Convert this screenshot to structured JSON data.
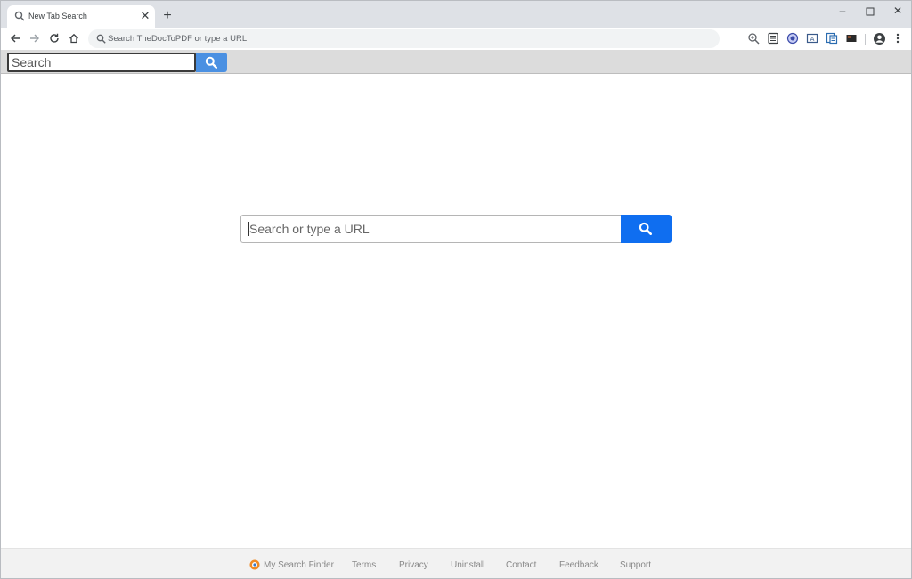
{
  "browser": {
    "tab": {
      "title": "New Tab Search",
      "favicon": "search-icon",
      "close_glyph": "✕"
    },
    "new_tab_glyph": "+",
    "window_controls": {
      "minimize": "–",
      "maximize": "☐",
      "close": "✕"
    },
    "omnibox": {
      "text": "Search TheDocToPDF or type a URL"
    },
    "extensions": [
      "zoom-icon",
      "note-icon",
      "record-icon",
      "translate-icon",
      "docs-icon",
      "media-icon"
    ]
  },
  "extension_bar": {
    "search_placeholder": "Search"
  },
  "main": {
    "search_placeholder": "Search or type a URL"
  },
  "footer": {
    "brand": "My Search Finder",
    "links": [
      "Terms",
      "Privacy",
      "Uninstall",
      "Contact",
      "Feedback",
      "Support"
    ]
  },
  "colors": {
    "tabstrip": "#dee1e6",
    "extbar": "#dcdcdc",
    "extbar_button": "#4a90e2",
    "main_button": "#0f6ef0",
    "footer_text": "#888888"
  }
}
